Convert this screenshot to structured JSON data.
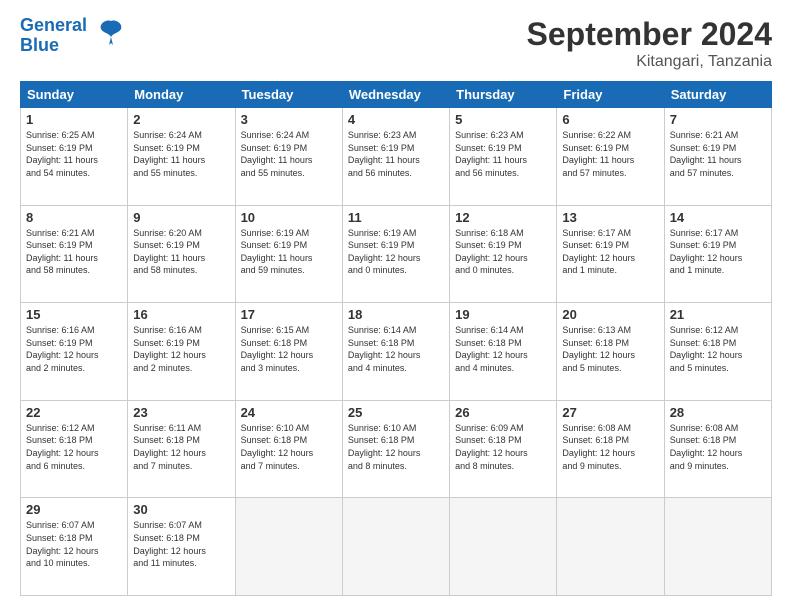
{
  "header": {
    "logo_line1": "General",
    "logo_line2": "Blue",
    "title": "September 2024",
    "subtitle": "Kitangari, Tanzania"
  },
  "days_of_week": [
    "Sunday",
    "Monday",
    "Tuesday",
    "Wednesday",
    "Thursday",
    "Friday",
    "Saturday"
  ],
  "weeks": [
    [
      {
        "day": "1",
        "info": "Sunrise: 6:25 AM\nSunset: 6:19 PM\nDaylight: 11 hours\nand 54 minutes."
      },
      {
        "day": "2",
        "info": "Sunrise: 6:24 AM\nSunset: 6:19 PM\nDaylight: 11 hours\nand 55 minutes."
      },
      {
        "day": "3",
        "info": "Sunrise: 6:24 AM\nSunset: 6:19 PM\nDaylight: 11 hours\nand 55 minutes."
      },
      {
        "day": "4",
        "info": "Sunrise: 6:23 AM\nSunset: 6:19 PM\nDaylight: 11 hours\nand 56 minutes."
      },
      {
        "day": "5",
        "info": "Sunrise: 6:23 AM\nSunset: 6:19 PM\nDaylight: 11 hours\nand 56 minutes."
      },
      {
        "day": "6",
        "info": "Sunrise: 6:22 AM\nSunset: 6:19 PM\nDaylight: 11 hours\nand 57 minutes."
      },
      {
        "day": "7",
        "info": "Sunrise: 6:21 AM\nSunset: 6:19 PM\nDaylight: 11 hours\nand 57 minutes."
      }
    ],
    [
      {
        "day": "8",
        "info": "Sunrise: 6:21 AM\nSunset: 6:19 PM\nDaylight: 11 hours\nand 58 minutes."
      },
      {
        "day": "9",
        "info": "Sunrise: 6:20 AM\nSunset: 6:19 PM\nDaylight: 11 hours\nand 58 minutes."
      },
      {
        "day": "10",
        "info": "Sunrise: 6:19 AM\nSunset: 6:19 PM\nDaylight: 11 hours\nand 59 minutes."
      },
      {
        "day": "11",
        "info": "Sunrise: 6:19 AM\nSunset: 6:19 PM\nDaylight: 12 hours\nand 0 minutes."
      },
      {
        "day": "12",
        "info": "Sunrise: 6:18 AM\nSunset: 6:19 PM\nDaylight: 12 hours\nand 0 minutes."
      },
      {
        "day": "13",
        "info": "Sunrise: 6:17 AM\nSunset: 6:19 PM\nDaylight: 12 hours\nand 1 minute."
      },
      {
        "day": "14",
        "info": "Sunrise: 6:17 AM\nSunset: 6:19 PM\nDaylight: 12 hours\nand 1 minute."
      }
    ],
    [
      {
        "day": "15",
        "info": "Sunrise: 6:16 AM\nSunset: 6:19 PM\nDaylight: 12 hours\nand 2 minutes."
      },
      {
        "day": "16",
        "info": "Sunrise: 6:16 AM\nSunset: 6:19 PM\nDaylight: 12 hours\nand 2 minutes."
      },
      {
        "day": "17",
        "info": "Sunrise: 6:15 AM\nSunset: 6:18 PM\nDaylight: 12 hours\nand 3 minutes."
      },
      {
        "day": "18",
        "info": "Sunrise: 6:14 AM\nSunset: 6:18 PM\nDaylight: 12 hours\nand 4 minutes."
      },
      {
        "day": "19",
        "info": "Sunrise: 6:14 AM\nSunset: 6:18 PM\nDaylight: 12 hours\nand 4 minutes."
      },
      {
        "day": "20",
        "info": "Sunrise: 6:13 AM\nSunset: 6:18 PM\nDaylight: 12 hours\nand 5 minutes."
      },
      {
        "day": "21",
        "info": "Sunrise: 6:12 AM\nSunset: 6:18 PM\nDaylight: 12 hours\nand 5 minutes."
      }
    ],
    [
      {
        "day": "22",
        "info": "Sunrise: 6:12 AM\nSunset: 6:18 PM\nDaylight: 12 hours\nand 6 minutes."
      },
      {
        "day": "23",
        "info": "Sunrise: 6:11 AM\nSunset: 6:18 PM\nDaylight: 12 hours\nand 7 minutes."
      },
      {
        "day": "24",
        "info": "Sunrise: 6:10 AM\nSunset: 6:18 PM\nDaylight: 12 hours\nand 7 minutes."
      },
      {
        "day": "25",
        "info": "Sunrise: 6:10 AM\nSunset: 6:18 PM\nDaylight: 12 hours\nand 8 minutes."
      },
      {
        "day": "26",
        "info": "Sunrise: 6:09 AM\nSunset: 6:18 PM\nDaylight: 12 hours\nand 8 minutes."
      },
      {
        "day": "27",
        "info": "Sunrise: 6:08 AM\nSunset: 6:18 PM\nDaylight: 12 hours\nand 9 minutes."
      },
      {
        "day": "28",
        "info": "Sunrise: 6:08 AM\nSunset: 6:18 PM\nDaylight: 12 hours\nand 9 minutes."
      }
    ],
    [
      {
        "day": "29",
        "info": "Sunrise: 6:07 AM\nSunset: 6:18 PM\nDaylight: 12 hours\nand 10 minutes."
      },
      {
        "day": "30",
        "info": "Sunrise: 6:07 AM\nSunset: 6:18 PM\nDaylight: 12 hours\nand 11 minutes."
      },
      {
        "day": "",
        "info": ""
      },
      {
        "day": "",
        "info": ""
      },
      {
        "day": "",
        "info": ""
      },
      {
        "day": "",
        "info": ""
      },
      {
        "day": "",
        "info": ""
      }
    ]
  ]
}
